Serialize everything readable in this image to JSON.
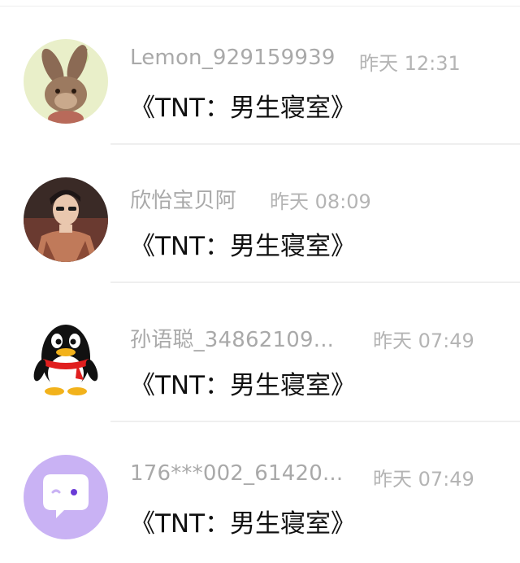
{
  "messages": [
    {
      "name": "Lemon_929159939",
      "time": "昨天 12:31",
      "text": "《TNT：男生寝室》",
      "avatar": "bunny-plush-avatar"
    },
    {
      "name": "欣怡宝贝阿",
      "time": "昨天 08:09",
      "text": "《TNT：男生寝室》",
      "avatar": "person-photo-avatar"
    },
    {
      "name": "孙语聪_34862109...",
      "time": "昨天 07:49",
      "text": "《TNT：男生寝室》",
      "avatar": "qq-penguin-avatar"
    },
    {
      "name": "176***002_61420...",
      "time": "昨天 07:49",
      "text": "《TNT：男生寝室》",
      "avatar": "default-chat-bubble-avatar"
    }
  ],
  "colors": {
    "name_gray": "#a9a9a9",
    "time_gray": "#b4b4b4",
    "message_black": "#111111",
    "default_avatar_purple": "#c9b2f4"
  }
}
